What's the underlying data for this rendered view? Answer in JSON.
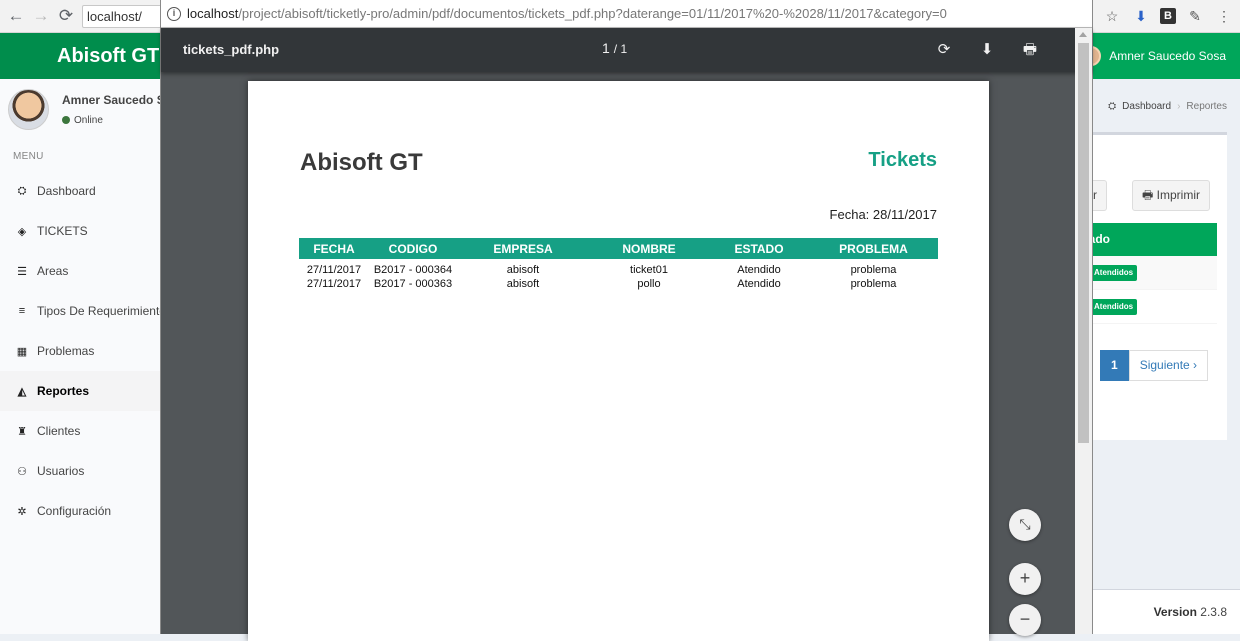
{
  "browser": {
    "back_glyph": "←",
    "forward_glyph": "→",
    "reload_glyph": "⟳",
    "omnibox_text": "localhost/",
    "ext_icons": [
      "☆",
      "⬇",
      "B",
      "✎",
      "⋮"
    ]
  },
  "app": {
    "brand": "Abisoft GT",
    "user_name": "Amner Saucedo Sosa",
    "status": "Online",
    "menu_header": "MENU",
    "menu": [
      {
        "label": "Dashboard",
        "icon": "⛭",
        "active": false
      },
      {
        "label": "TICKETS",
        "icon": "◈",
        "active": false
      },
      {
        "label": "Areas",
        "icon": "☰",
        "active": false
      },
      {
        "label": "Tipos De Requerimientos",
        "icon": "≡",
        "active": false
      },
      {
        "label": "Problemas",
        "icon": "▦",
        "active": false
      },
      {
        "label": "Reportes",
        "icon": "◭",
        "active": true
      },
      {
        "label": "Clientes",
        "icon": "♜",
        "active": false
      },
      {
        "label": "Usuarios",
        "icon": "⚇",
        "active": false
      },
      {
        "label": "Configuración",
        "icon": "✲",
        "active": false
      }
    ],
    "breadcrumb": {
      "home": "Dashboard",
      "current": "Reportes"
    },
    "buttons": {
      "download": "argar",
      "print": "Imprimir",
      "print_icon": "🖶"
    },
    "table_header": "Estado",
    "rows": [
      {
        "status": "Atendidos"
      },
      {
        "status": "Atendidos"
      }
    ],
    "pagination": {
      "current": "1",
      "next": "Siguiente ›"
    },
    "version_label": "Version",
    "version_number": "2.3.8",
    "accent": "#00a65a"
  },
  "popup": {
    "url_host": "localhost",
    "url_path": "/project/abisoft/ticketly-pro/admin/pdf/documentos/tickets_pdf.php?daterange=01/11/2017%20-%2028/11/2017&category=0",
    "viewer": {
      "file_name": "tickets_pdf.php",
      "page_current": "1",
      "page_total": "/ 1",
      "rotate_icon": "⟳",
      "download_icon": "⬇",
      "print_icon": "🖶",
      "fit_icon": "⤡",
      "zoom_in_icon": "+",
      "zoom_out_icon": "−"
    },
    "document": {
      "brand": "Abisoft GT",
      "title": "Tickets",
      "date": "Fecha: 28/11/2017",
      "accent": "#16a085",
      "columns": [
        "FECHA",
        "CODIGO",
        "EMPRESA",
        "NOMBRE",
        "ESTADO",
        "PROBLEMA"
      ],
      "rows": [
        [
          "27/11/2017",
          "B2017 - 000364",
          "abisoft",
          "ticket01",
          "Atendido",
          "problema"
        ],
        [
          "27/11/2017",
          "B2017 - 000363",
          "abisoft",
          "pollo",
          "Atendido",
          "problema"
        ]
      ]
    }
  }
}
